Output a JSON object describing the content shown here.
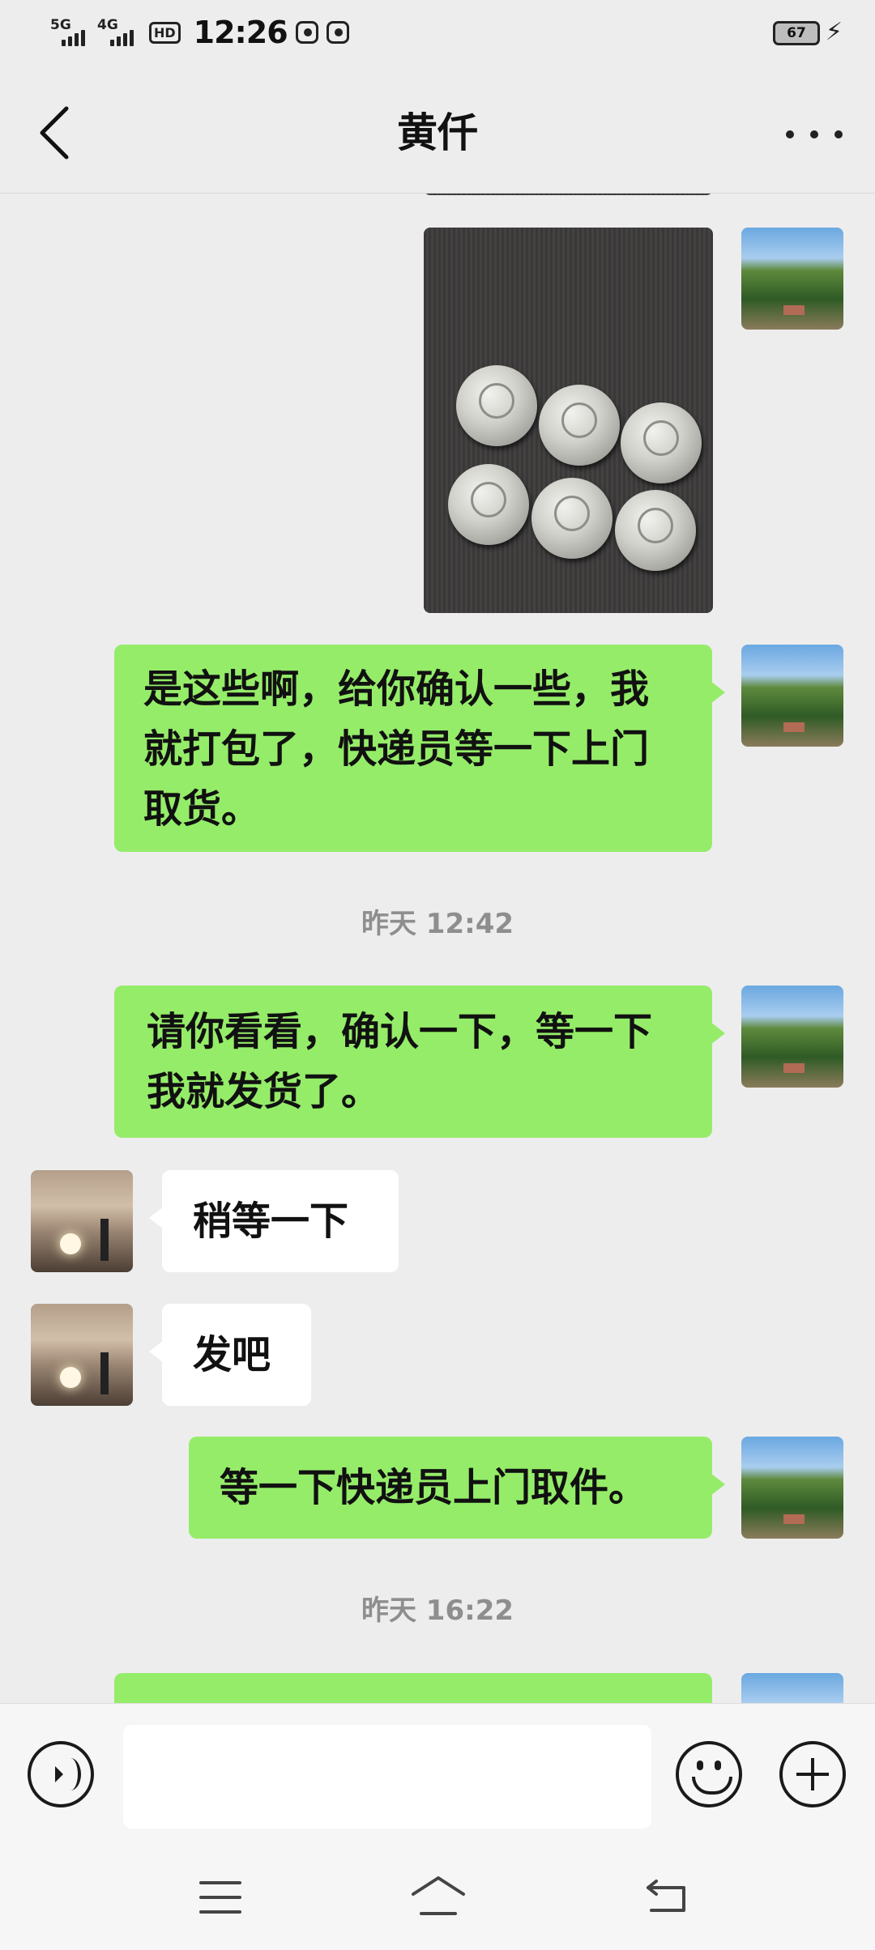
{
  "status_bar": {
    "signal1_label": "5G",
    "signal2_label": "4G",
    "hd_label": "HD",
    "time": "12:26",
    "battery_level": "67",
    "icons": [
      "app-icon-a",
      "video-icon",
      "charging-icon"
    ]
  },
  "header": {
    "title": "黄仟",
    "back_icon": "chevron-left-icon",
    "more_icon": "more-icon"
  },
  "messages": {
    "m1": "是这些啊，给你确认一些，我就打包了，快递员等一下上门取货。",
    "ts1": "昨天 12:42",
    "m2": "请你看看，确认一下，等一下我就发货了。",
    "m3": "稍等一下",
    "m4": "发吧",
    "m5": "等一下快递员上门取件。",
    "ts2": "昨天 16:22"
  },
  "input_bar": {
    "placeholder": "",
    "icons": [
      "voice-icon",
      "emoji-icon",
      "plus-icon"
    ]
  },
  "system_nav": {
    "icons": [
      "menu-icon",
      "home-icon",
      "back-icon"
    ]
  }
}
